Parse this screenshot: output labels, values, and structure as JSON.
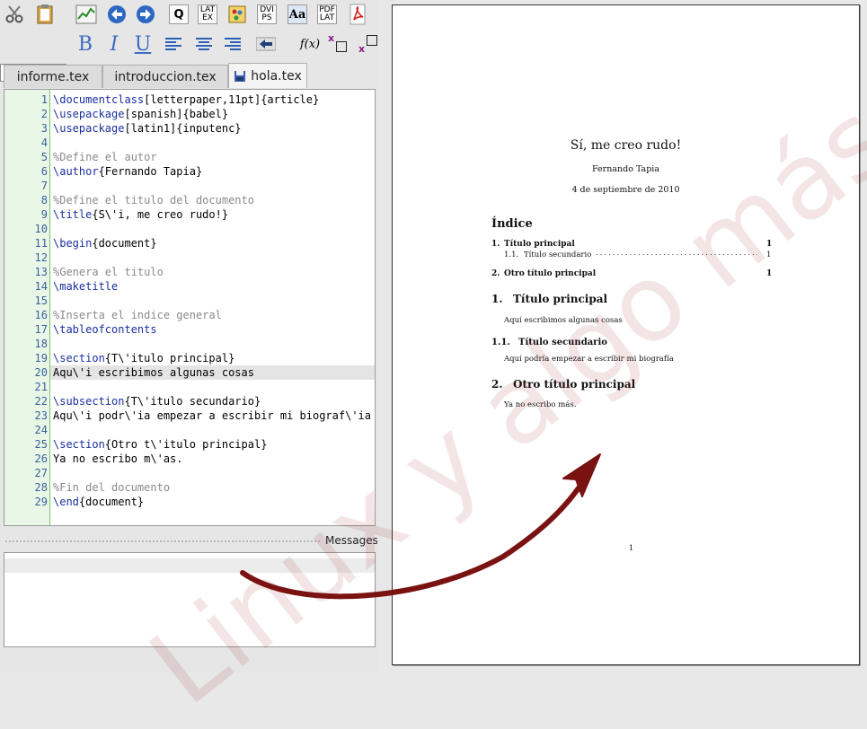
{
  "toolbar": {
    "latex_btn": "LAT EX",
    "dvips_btn": "DVI PS",
    "font_btn": "Aa",
    "pdflatex_btn": "PDF LAT",
    "query_btn": "Q",
    "bold_label": "B",
    "italic_label": "I",
    "underline_label": "U",
    "fx_label": "f(x)",
    "sup_label": "x",
    "sub_label": "x"
  },
  "tabs": [
    "informe.tex",
    "introduccion.tex",
    "hola.tex"
  ],
  "code_lines": [
    {
      "n": "1",
      "segments": [
        {
          "t": "\\documentclass",
          "c": "cmd"
        },
        {
          "t": "[letterpaper,11pt]{article}",
          "c": ""
        }
      ]
    },
    {
      "n": "2",
      "segments": [
        {
          "t": "\\usepackage",
          "c": "cmd"
        },
        {
          "t": "[spanish]{babel}",
          "c": ""
        }
      ]
    },
    {
      "n": "3",
      "segments": [
        {
          "t": "\\usepackage",
          "c": "cmd"
        },
        {
          "t": "[latin1]{inputenc}",
          "c": ""
        }
      ]
    },
    {
      "n": "4",
      "segments": []
    },
    {
      "n": "5",
      "segments": [
        {
          "t": "%Define el autor",
          "c": "cmt"
        }
      ]
    },
    {
      "n": "6",
      "segments": [
        {
          "t": "\\author",
          "c": "cmd"
        },
        {
          "t": "{Fernando Tapia}",
          "c": ""
        }
      ]
    },
    {
      "n": "7",
      "segments": []
    },
    {
      "n": "8",
      "segments": [
        {
          "t": "%Define el titulo del documento",
          "c": "cmt"
        }
      ]
    },
    {
      "n": "9",
      "segments": [
        {
          "t": "\\title",
          "c": "cmd"
        },
        {
          "t": "{S\\'i, me creo rudo!}",
          "c": ""
        }
      ]
    },
    {
      "n": "10",
      "segments": []
    },
    {
      "n": "11",
      "segments": [
        {
          "t": "\\begin",
          "c": "cmd"
        },
        {
          "t": "{document}",
          "c": ""
        }
      ]
    },
    {
      "n": "12",
      "segments": []
    },
    {
      "n": "13",
      "segments": [
        {
          "t": "%Genera el titulo",
          "c": "cmt"
        }
      ]
    },
    {
      "n": "14",
      "segments": [
        {
          "t": "\\maketitle",
          "c": "cmd"
        }
      ]
    },
    {
      "n": "15",
      "segments": []
    },
    {
      "n": "16",
      "segments": [
        {
          "t": "%Inserta el indice general",
          "c": "cmt"
        }
      ]
    },
    {
      "n": "17",
      "segments": [
        {
          "t": "\\tableofcontents",
          "c": "cmd"
        }
      ]
    },
    {
      "n": "18",
      "segments": []
    },
    {
      "n": "19",
      "segments": [
        {
          "t": "\\section",
          "c": "cmd"
        },
        {
          "t": "{T\\'itulo principal}",
          "c": ""
        }
      ]
    },
    {
      "n": "20",
      "segments": [
        {
          "t": "Aqu\\'i escribimos algunas cosas",
          "c": ""
        }
      ]
    },
    {
      "n": "21",
      "segments": []
    },
    {
      "n": "22",
      "segments": [
        {
          "t": "\\subsection",
          "c": "cmd"
        },
        {
          "t": "{T\\'itulo secundario}",
          "c": ""
        }
      ]
    },
    {
      "n": "23",
      "segments": [
        {
          "t": "Aqu\\'i podr\\'ia empezar a escribir mi biograf\\'ia",
          "c": ""
        }
      ]
    },
    {
      "n": "24",
      "segments": []
    },
    {
      "n": "25",
      "segments": [
        {
          "t": "\\section",
          "c": "cmd"
        },
        {
          "t": "{Otro t\\'itulo principal}",
          "c": ""
        }
      ]
    },
    {
      "n": "26",
      "segments": [
        {
          "t": "Ya no escribo m\\'as.",
          "c": ""
        }
      ]
    },
    {
      "n": "27",
      "segments": []
    },
    {
      "n": "28",
      "segments": [
        {
          "t": "%Fin del documento",
          "c": "cmt"
        }
      ]
    },
    {
      "n": "29",
      "segments": [
        {
          "t": "\\end",
          "c": "cmd"
        },
        {
          "t": "{document}",
          "c": ""
        }
      ]
    }
  ],
  "messages_label": "Messages",
  "doc": {
    "title": "Sí, me creo rudo!",
    "author": "Fernando Tapia",
    "date": "4 de septiembre de 2010",
    "toc_heading": "Índice",
    "toc_1_num": "1.",
    "toc_1_title": "Título principal",
    "toc_1_page": "1",
    "toc_11_num": "1.1.",
    "toc_11_title": "Título secundario",
    "toc_11_page": "1",
    "toc_2_num": "2.",
    "toc_2_title": "Otro título principal",
    "toc_2_page": "1",
    "sec1_num": "1.",
    "sec1_title": "Título principal",
    "sec1_body": "Aquí escribimos algunas cosas",
    "sub11_num": "1.1.",
    "sub11_title": "Título secundario",
    "sub11_body": "Aquí podría empezar a escribir mi biografía",
    "sec2_num": "2.",
    "sec2_title": "Otro título principal",
    "sec2_body": "Ya no escribo más.",
    "page_number": "1"
  },
  "watermark": "Linux y algo más",
  "colors": {
    "arrow": "#7a1212",
    "command": "#1b2fa0",
    "comment": "#8a8a8a",
    "gutter": "#e9f7e6",
    "line_number": "#3a5fa0"
  },
  "icons": [
    "scissors-icon",
    "clipboard-icon",
    "chart-icon",
    "back-arrow-icon",
    "forward-arrow-icon",
    "search-doc-icon",
    "latex-icon",
    "palette-icon",
    "dvips-icon",
    "font-icon",
    "pdflatex-icon",
    "pdf-icon",
    "align-left-icon",
    "align-center-icon",
    "align-right-icon",
    "backspace-icon",
    "save-icon"
  ]
}
